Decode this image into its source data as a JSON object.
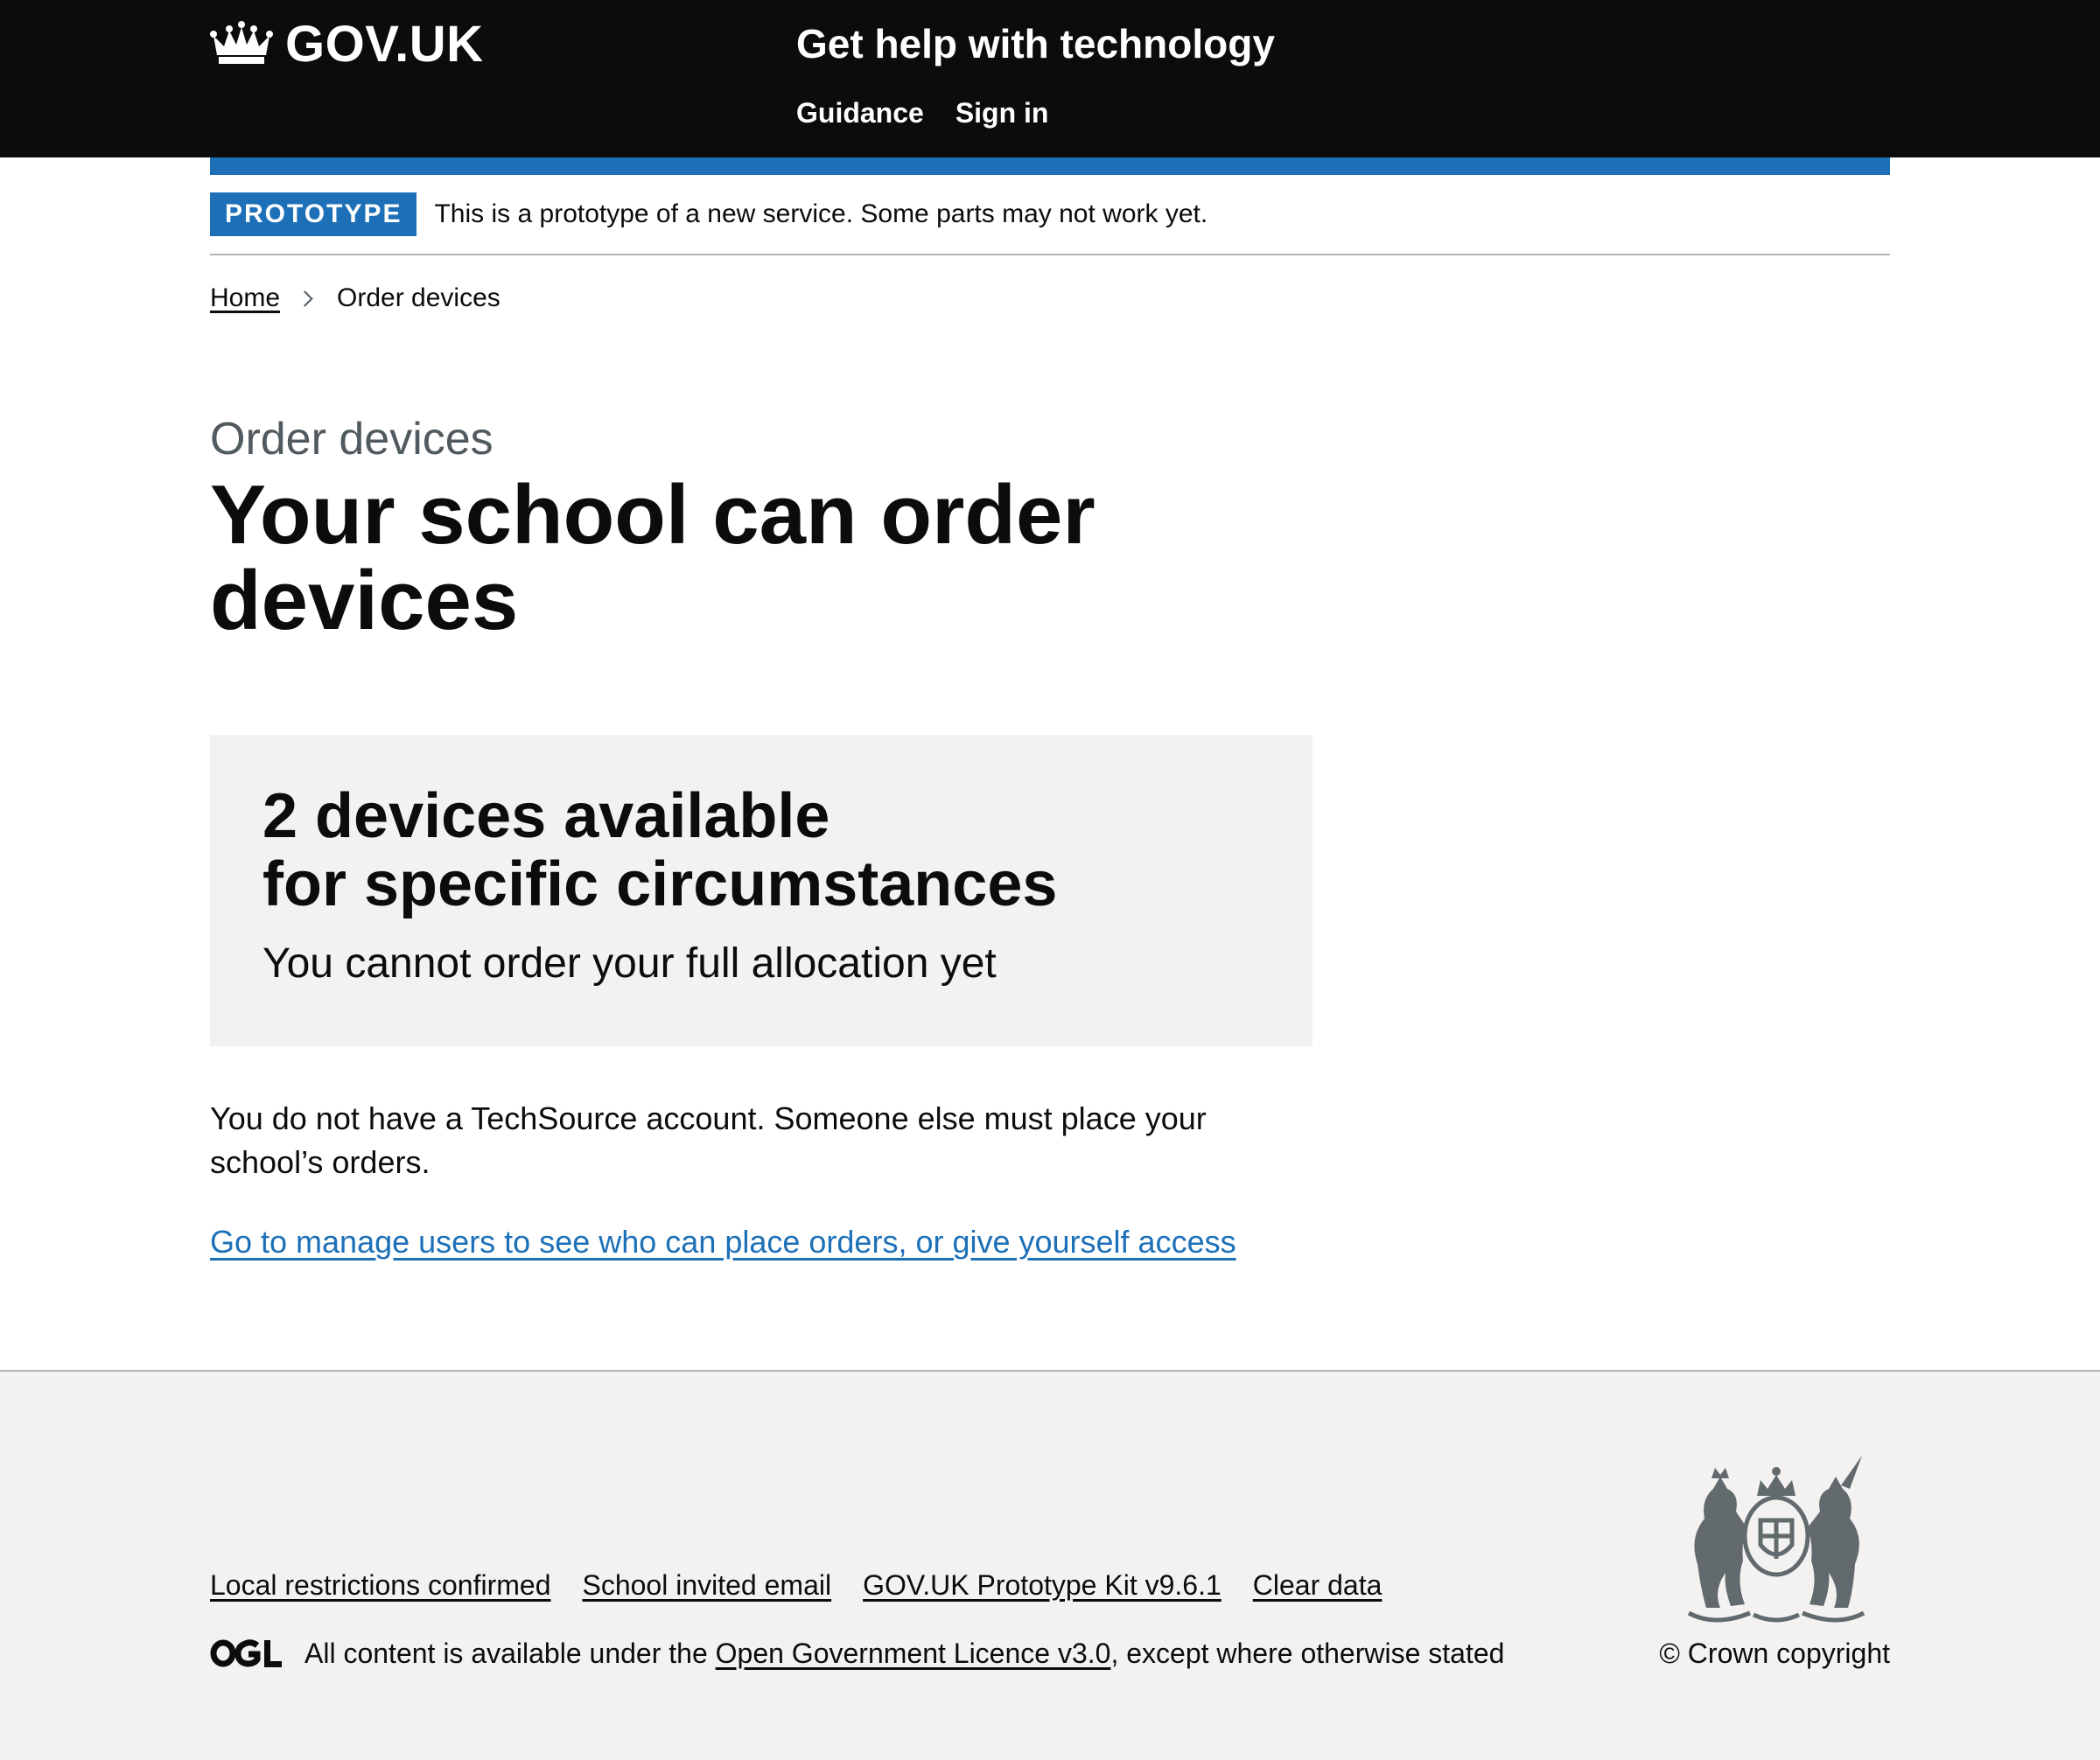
{
  "header": {
    "logo_text": "GOV.UK",
    "service_name": "Get help with technology",
    "nav": [
      "Guidance",
      "Sign in"
    ]
  },
  "phase_banner": {
    "tag": "PROTOTYPE",
    "text": "This is a prototype of a new service. Some parts may not work yet."
  },
  "breadcrumbs": {
    "home": "Home",
    "current": "Order devices"
  },
  "main": {
    "caption": "Order devices",
    "title": "Your school can order devices",
    "panel": {
      "heading_line1": "2 devices available",
      "heading_line2": "for specific circumstances",
      "subtext": "You cannot order your full allocation yet"
    },
    "body": "You do not have a TechSource account. Someone else must place your school’s orders.",
    "link": "Go to manage users to see who can place orders, or give yourself access"
  },
  "footer": {
    "links": [
      "Local restrictions confirmed",
      "School invited email",
      "GOV.UK Prototype Kit v9.6.1",
      "Clear data"
    ],
    "licence_prefix": "All content is available under the ",
    "licence_link": "Open Government Licence v3.0",
    "licence_suffix": ", except where otherwise stated",
    "copyright": "© Crown copyright"
  },
  "colors": {
    "header_bg": "#0b0c0c",
    "brand_blue": "#1d70b8",
    "link_blue": "#1d70b8",
    "panel_bg": "#f3f2f1",
    "secondary_text": "#505a5f"
  },
  "icons": {
    "logo": "crown-icon",
    "breadcrumb_separator": "chevron-right-icon",
    "licence": "ogl-logo",
    "crest": "royal-coat-of-arms"
  }
}
